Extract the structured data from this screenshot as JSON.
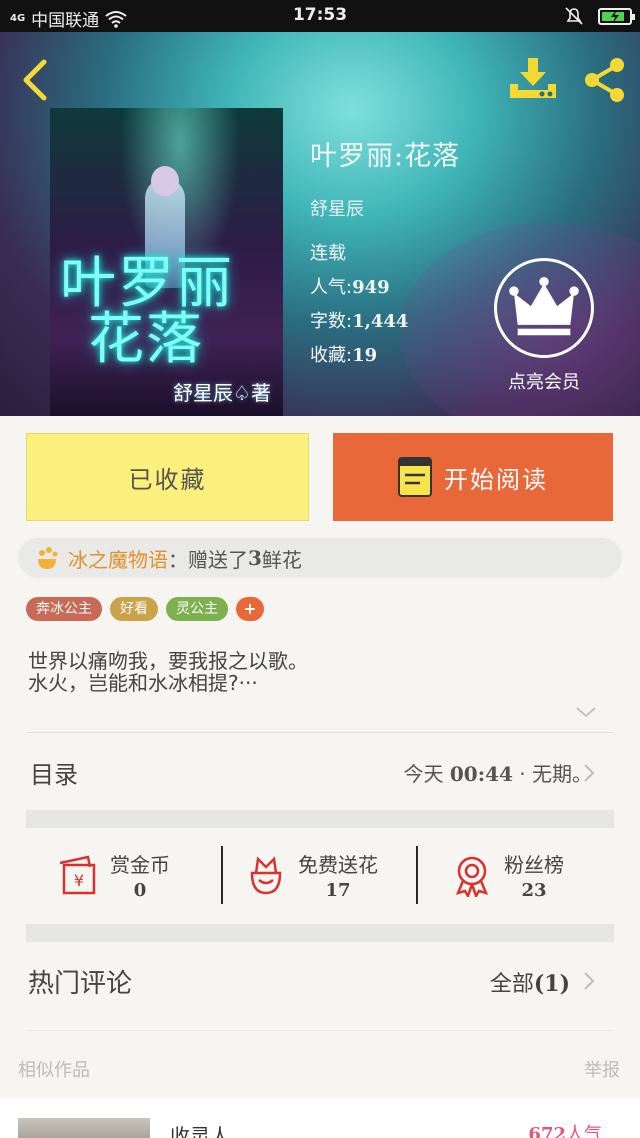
{
  "status_bar": {
    "network": "4G",
    "carrier": "中国联通",
    "time": "17:53"
  },
  "book": {
    "title": "叶罗丽:花落",
    "author": "舒星辰",
    "status": "连载",
    "popularity_label": "人气:",
    "popularity": "949",
    "word_count_label": "字数:",
    "word_count": "1,444",
    "favorites_label": "收藏:",
    "favorites": "19",
    "cover_title_line1": "叶罗丽",
    "cover_title_line2": "花落",
    "cover_author": "舒星辰♤著"
  },
  "vip": {
    "label": "点亮会员"
  },
  "actions": {
    "favorite_label": "已收藏",
    "read_label": "开始阅读"
  },
  "ticker": {
    "user": "冰之魔物语",
    "text_prefix": "：赠送了",
    "count": "3",
    "text_suffix": "鲜花"
  },
  "tags": [
    {
      "label": "奔冰公主",
      "color": "#c86a55"
    },
    {
      "label": "好看",
      "color": "#c9a24a"
    },
    {
      "label": "灵公主",
      "color": "#7fb04f"
    }
  ],
  "tag_add": "+",
  "intro": {
    "line1": "世界以痛吻我，要我报之以歌。",
    "line2": "水火，岂能和水冰相提?···"
  },
  "catalog": {
    "label": "目录",
    "update_prefix": "今天",
    "update_time": "00:44",
    "update_suffix": "· 无期。"
  },
  "stats": [
    {
      "label": "赏金币",
      "value": "0",
      "icon": "red-envelope-icon"
    },
    {
      "label": "免费送花",
      "value": "17",
      "icon": "flower-icon"
    },
    {
      "label": "粉丝榜",
      "value": "23",
      "icon": "rosette-icon"
    }
  ],
  "comments": {
    "label": "热门评论",
    "all_label": "全部",
    "all_count": "(1)"
  },
  "similar": {
    "label": "相似作品",
    "report_label": "举报",
    "first_title": "收灵人",
    "first_popularity": "672",
    "first_popularity_unit": "人气"
  },
  "colors": {
    "accent_orange": "#e8683a",
    "favorite_yellow": "#fbf07d",
    "ticker_user": "#e2912b",
    "popularity_pink": "#e5567f"
  }
}
